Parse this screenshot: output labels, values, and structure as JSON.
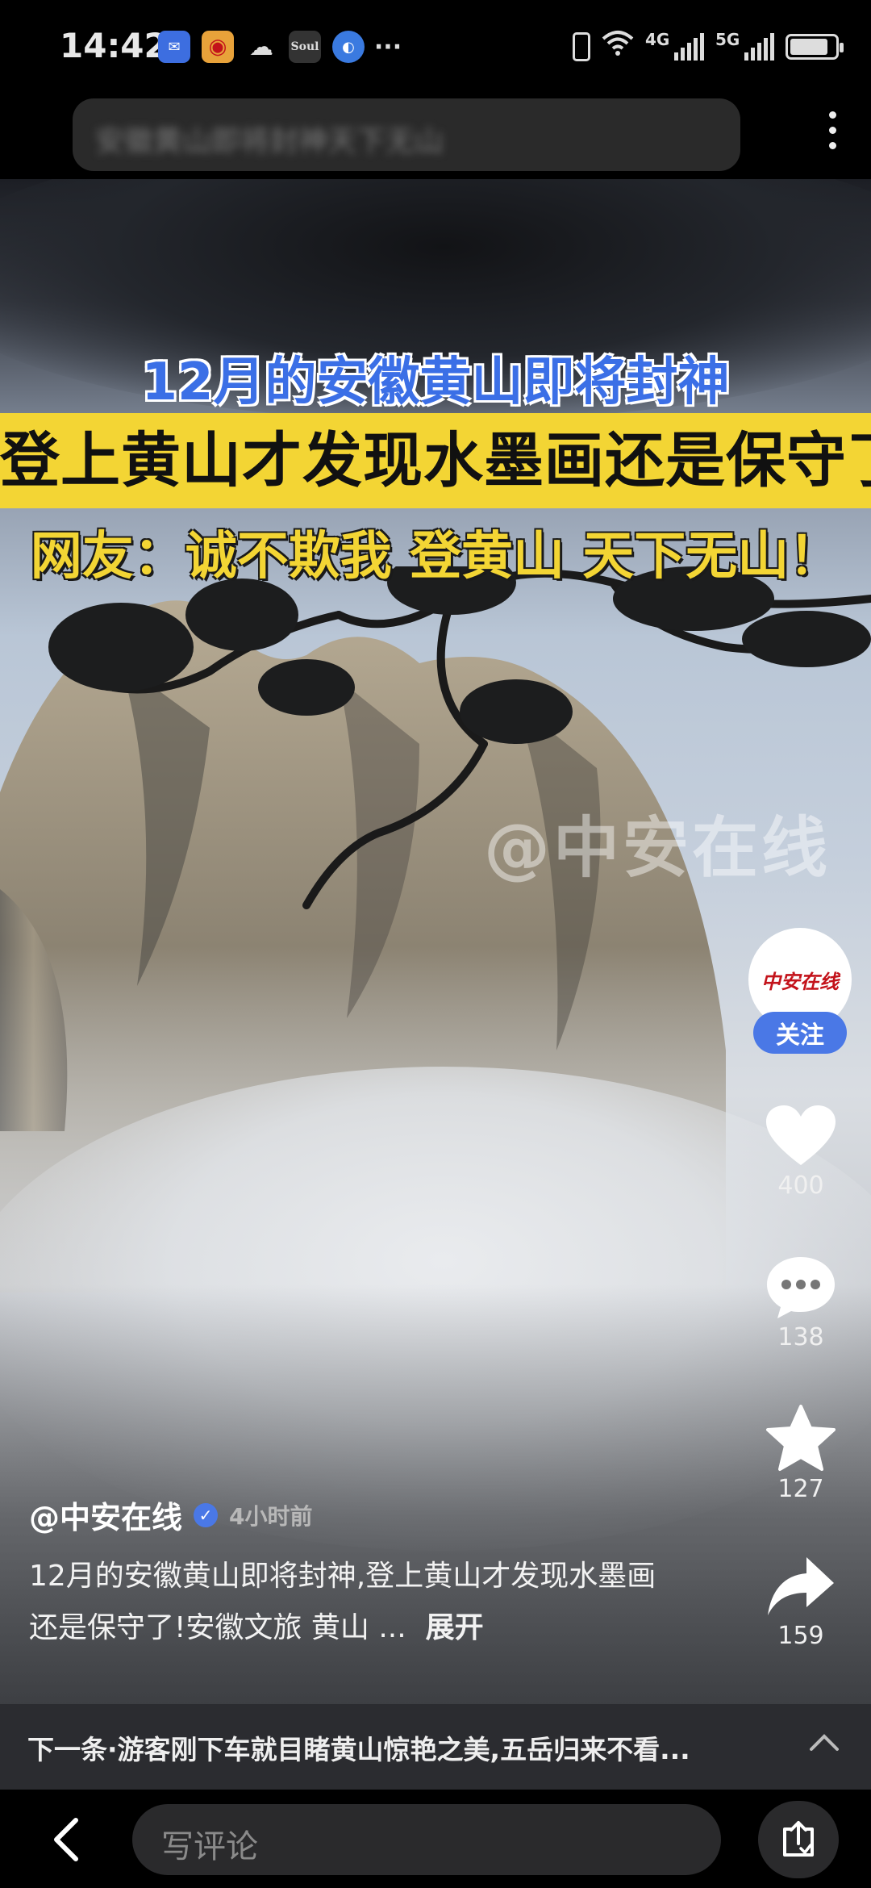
{
  "status_bar": {
    "time": "14:42",
    "notification_icons": [
      "message-icon",
      "weibo-icon",
      "wechat-icon",
      "soul-icon",
      "browser-icon"
    ],
    "soul_label": "Soul",
    "more": "···",
    "network_labels": [
      "4G",
      "5G"
    ],
    "battery_level": 0.85
  },
  "top_bar": {
    "search_text": "安徽黄山即将封神天下无山"
  },
  "video": {
    "caption_line1": "12月的安徽黄山即将封神",
    "caption_line2": "登上黄山才发现水墨画还是保守了",
    "caption_line3": "网友：诚不欺我 登黄山 天下无山！",
    "watermark": "@中安在线"
  },
  "side_actions": {
    "avatar_text": "中安在线",
    "follow_label": "关注",
    "like_count": "400",
    "comment_count": "138",
    "favorite_count": "127",
    "share_count": "159"
  },
  "post": {
    "author": "@中安在线",
    "time_ago": "4小时前",
    "description": "12月的安徽黄山即将封神,登上黄山才发现水墨画还是保守了!安徽文旅 黄山 ...",
    "expand_label": "展开"
  },
  "next_bar": {
    "text": "下一条·游客刚下车就目睹黄山惊艳之美,五岳归来不看..."
  },
  "bottom_bar": {
    "comment_placeholder": "写评论"
  }
}
